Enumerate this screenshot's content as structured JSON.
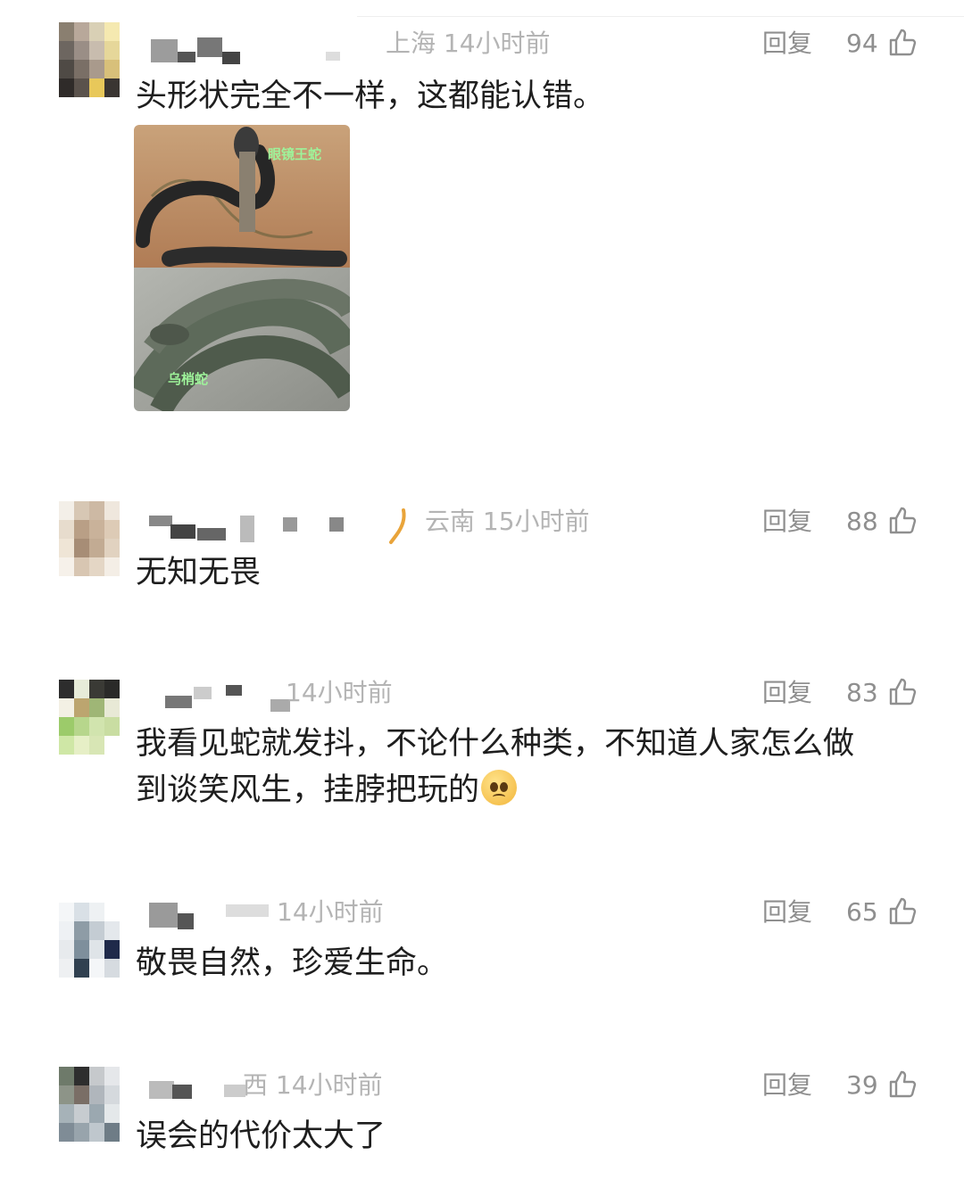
{
  "comments": [
    {
      "region": "上海",
      "time": "14小时前",
      "reply": "回复",
      "likes": "94",
      "text": "头形状完全不一样，这都能认错。",
      "image_captions": [
        "眼镜王蛇",
        "乌梢蛇"
      ]
    },
    {
      "region": "云南",
      "time": "15小时前",
      "reply": "回复",
      "likes": "88",
      "text": "无知无畏"
    },
    {
      "region": "",
      "time": "14小时前",
      "reply": "回复",
      "likes": "83",
      "text_line1": "我看见蛇就发抖，不论什么种类，不知道人家怎么做",
      "text_line2": "到谈笑风生，挂脖把玩的"
    },
    {
      "region": "",
      "time": "14小时前",
      "reply": "回复",
      "likes": "65",
      "text": "敬畏自然，珍爱生命。"
    },
    {
      "region": "西",
      "time": "14小时前",
      "reply": "回复",
      "likes": "39",
      "text": "误会的代价太大了"
    }
  ],
  "icons": {
    "like": "thumbs-up-icon",
    "emoji": "pleading-face-emoji",
    "badge": "pen-badge-icon"
  },
  "colors": {
    "meta": "#b4b4b4",
    "text": "#1e1e1e",
    "action": "#8f8f8f"
  }
}
